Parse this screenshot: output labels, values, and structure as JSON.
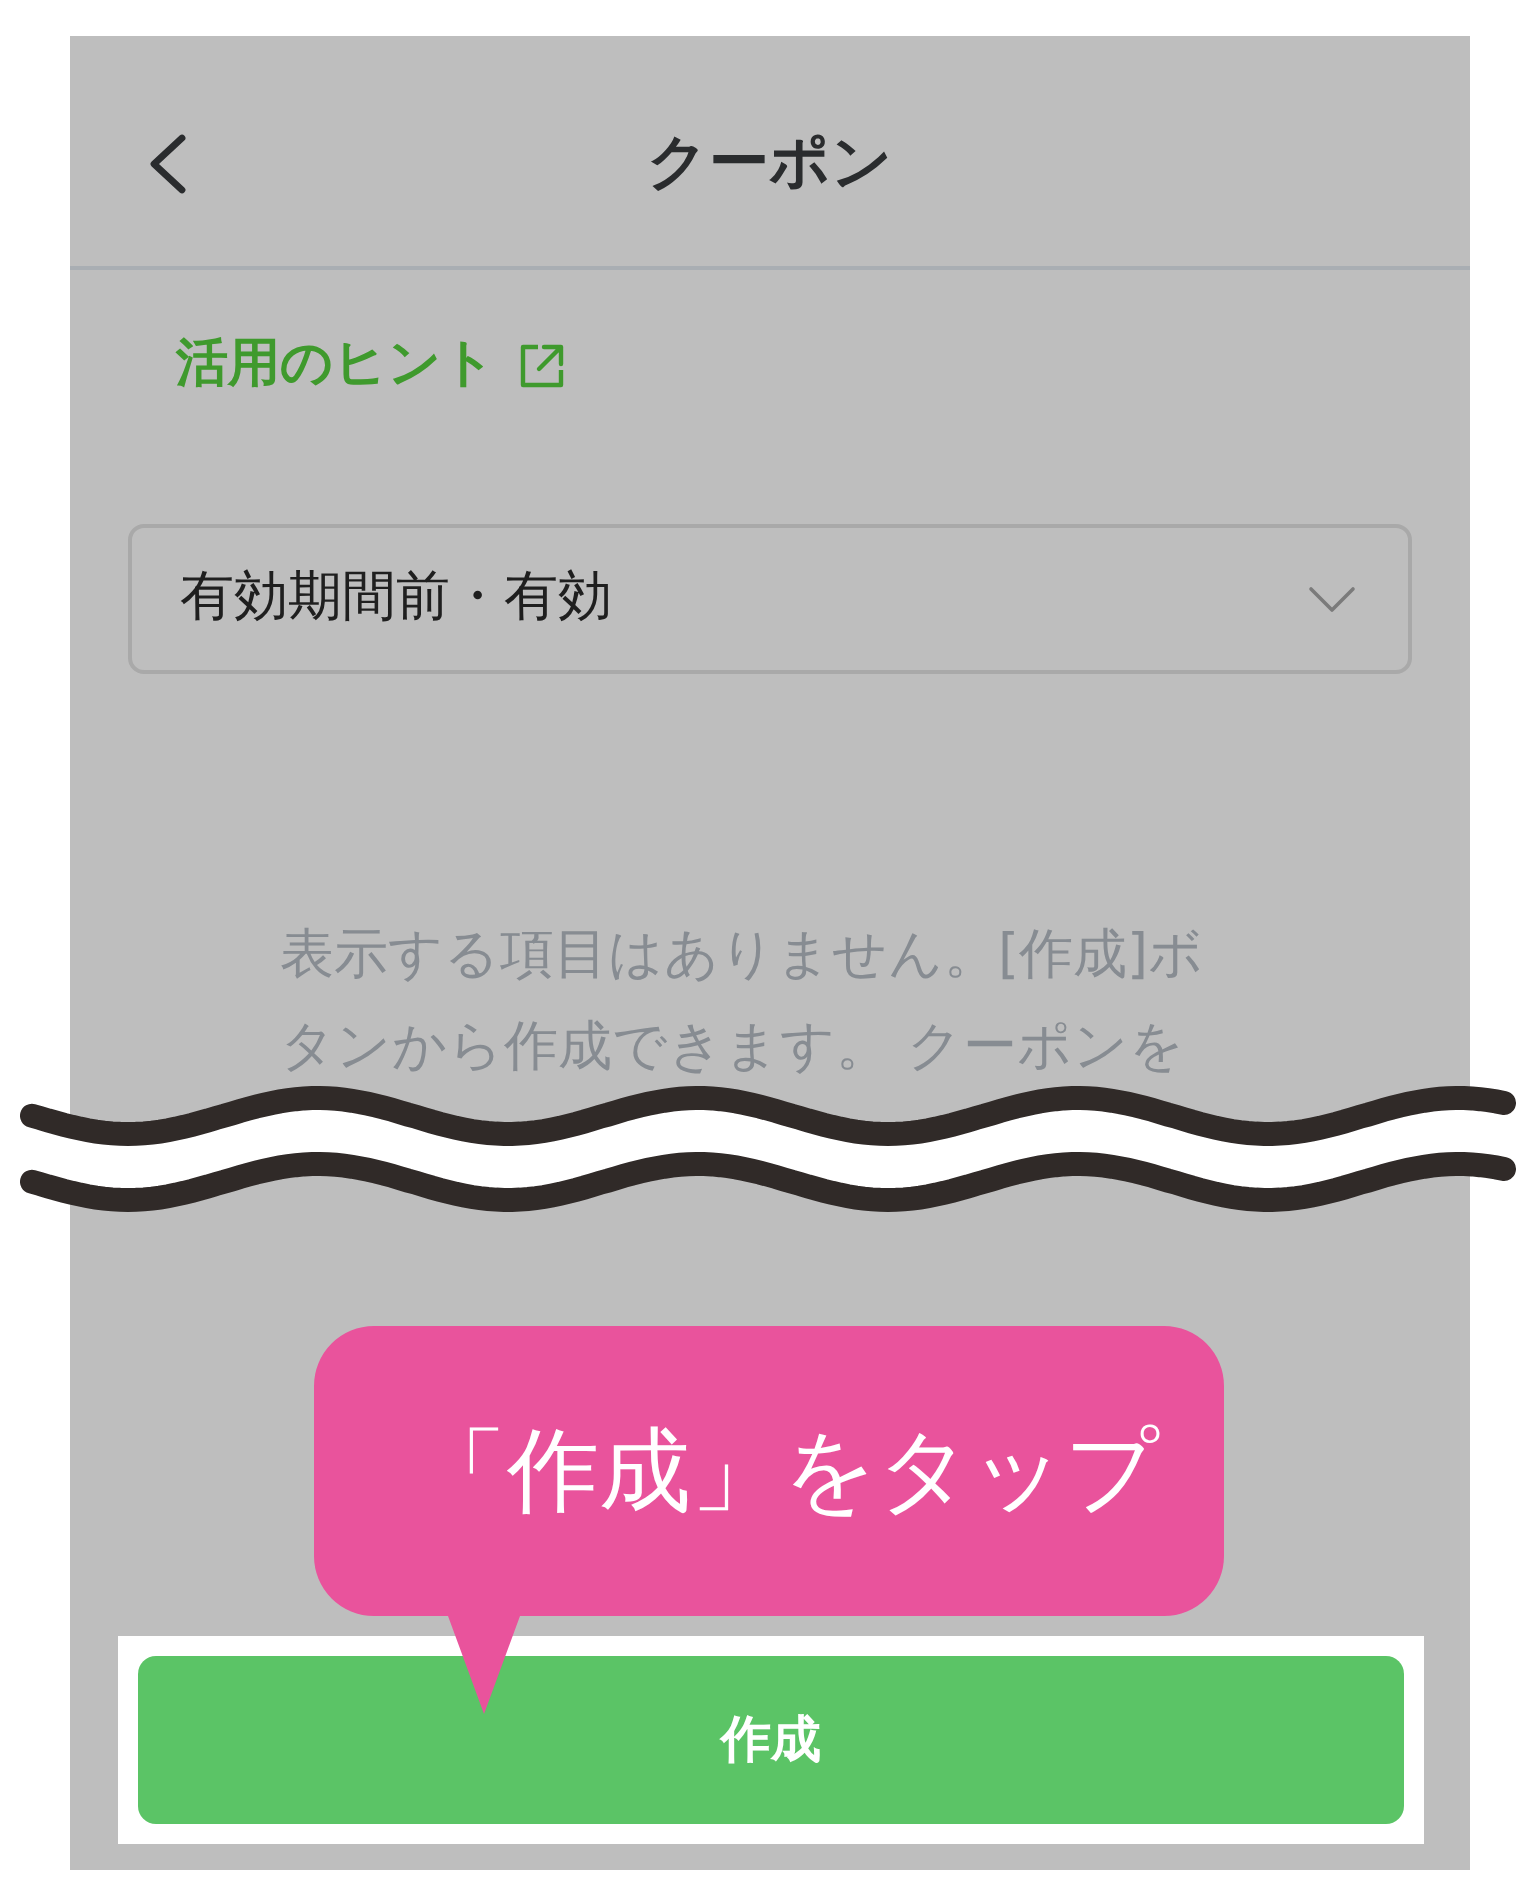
{
  "header": {
    "title": "クーポン"
  },
  "hint_link": {
    "label": "活用のヒント"
  },
  "filter": {
    "value": "有効期間前・有効"
  },
  "empty_state": {
    "message": "表示する項目はありません。[作成]ボタンから作成できます。 クーポンを"
  },
  "callout": {
    "text": "「作成」をタップ"
  },
  "create_button": {
    "label": "作成",
    "highlighted": true
  }
}
